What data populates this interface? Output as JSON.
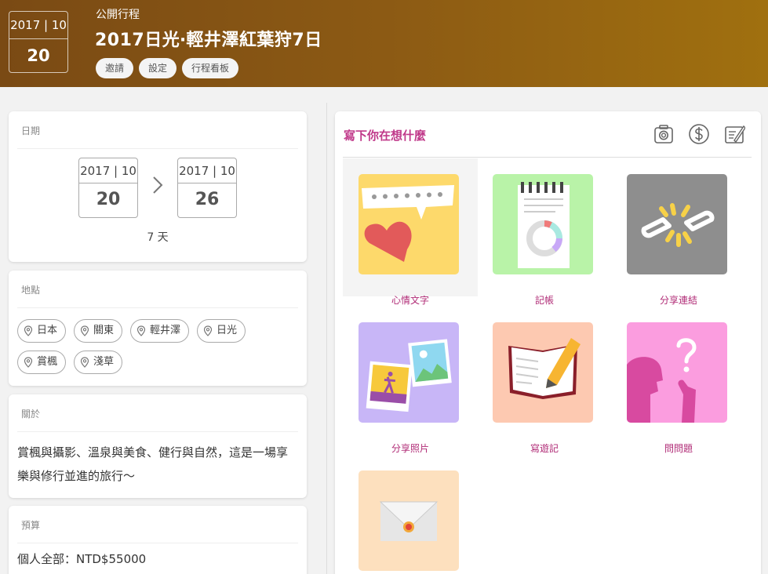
{
  "header": {
    "date_ym": "2017 | 10",
    "date_day": "20",
    "subtitle": "公開行程",
    "title": "2017日光‧輕井澤紅葉狩7日",
    "buttons": [
      "邀請",
      "設定",
      "行程看板"
    ]
  },
  "date_card": {
    "heading": "日期",
    "start_ym": "2017 | 10",
    "start_day": "20",
    "end_ym": "2017 | 10",
    "end_day": "26",
    "duration": "7 天"
  },
  "location_card": {
    "heading": "地點",
    "tags": [
      "日本",
      "關東",
      "輕井澤",
      "日光",
      "賞楓",
      "淺草"
    ]
  },
  "about_card": {
    "heading": "關於",
    "text": "賞楓與攝影、溫泉與美食、健行與自然，這是一場享樂與修行並進的旅行～"
  },
  "budget_card": {
    "heading": "預算",
    "text": "個人全部：NTD$55000"
  },
  "compose": {
    "title": "寫下你在想什麼",
    "toolbar_icons": [
      "camera-icon",
      "dollar-icon",
      "note-icon"
    ],
    "tiles": [
      {
        "label": "心情文字",
        "icon": "mood-text-icon",
        "bg": "#fdd96b"
      },
      {
        "label": "記帳",
        "icon": "expense-icon",
        "bg": "#b9f3a8"
      },
      {
        "label": "分享連結",
        "icon": "link-icon",
        "bg": "#8e8e8e"
      },
      {
        "label": "分享照片",
        "icon": "photo-icon",
        "bg": "#c8b6f7"
      },
      {
        "label": "寫遊記",
        "icon": "journal-icon",
        "bg": "#fdc9b1"
      },
      {
        "label": "問問題",
        "icon": "question-icon",
        "bg": "#fb9ddf"
      },
      {
        "label": "",
        "icon": "letter-icon",
        "bg": "#fde0be"
      }
    ]
  },
  "colors": {
    "accent": "#c0398a",
    "header_start": "#7a4a14",
    "header_end": "#a0700f"
  }
}
